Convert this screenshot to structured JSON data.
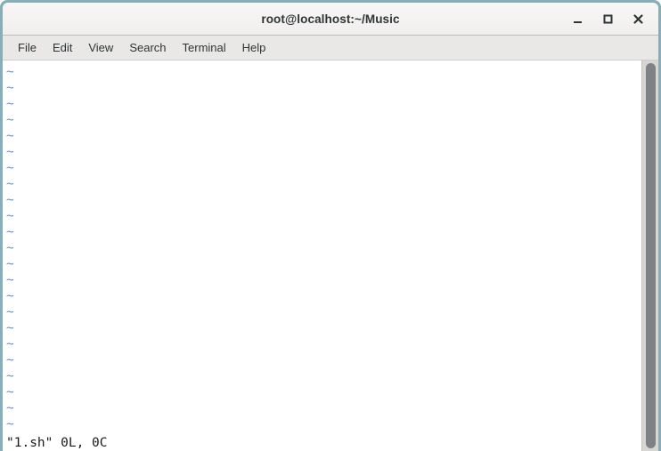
{
  "window": {
    "title": "root@localhost:~/Music",
    "border_color": "#88aeb8",
    "titlebar_color": "#f6f5f4",
    "controls": [
      {
        "name": "minimize",
        "label": "_"
      },
      {
        "name": "maximize",
        "label": "□"
      },
      {
        "name": "close",
        "label": "✕"
      }
    ]
  },
  "menubar": {
    "items": [
      {
        "label": "File"
      },
      {
        "label": "Edit"
      },
      {
        "label": "View"
      },
      {
        "label": "Search"
      },
      {
        "label": "Terminal"
      },
      {
        "label": "Help"
      }
    ]
  },
  "terminal": {
    "background": "#ffffff",
    "foreground": "#1f1f1f",
    "tilde_color": "#6c8fc7",
    "editor": "vim",
    "empty_line_marker": "~",
    "empty_line_count": 23,
    "status_line": "\"1.sh\" 0L, 0C",
    "lines": [
      "~",
      "~",
      "~",
      "~",
      "~",
      "~",
      "~",
      "~",
      "~",
      "~",
      "~",
      "~",
      "~",
      "~",
      "~",
      "~",
      "~",
      "~",
      "~",
      "~",
      "~",
      "~",
      "~"
    ]
  },
  "scrollbar": {
    "thumb_color": "#7e8286",
    "track_color": "#d8d6d3"
  }
}
